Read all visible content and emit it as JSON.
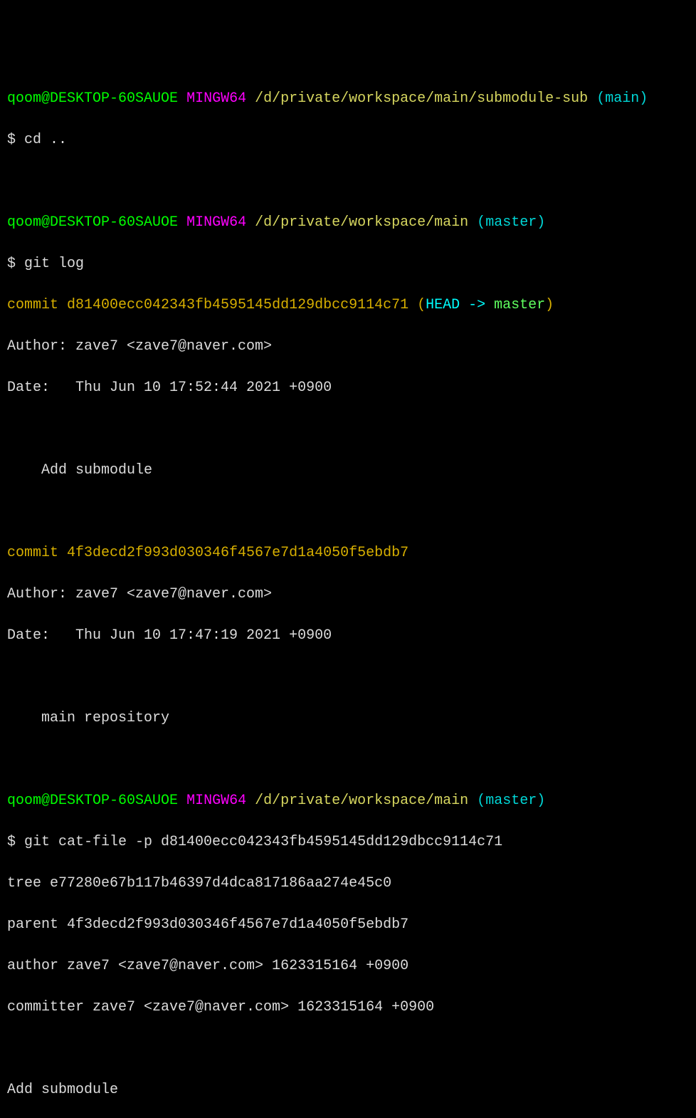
{
  "prompt1": {
    "user": "qoom@DESKTOP-60SAUOE",
    "shell": "MINGW64",
    "path": "/d/private/workspace/main/submodule-sub",
    "branch_open": "(",
    "branch": "main",
    "branch_close": ")"
  },
  "cmd1": "$ cd ..",
  "prompt2": {
    "user": "qoom@DESKTOP-60SAUOE",
    "shell": "MINGW64",
    "path": "/d/private/workspace/main",
    "branch_open": "(",
    "branch": "master",
    "branch_close": ")"
  },
  "cmd2": "$ git log",
  "log1": {
    "commit_label": "commit ",
    "hash": "d81400ecc042343fb4595145dd129dbcc9114c71",
    "ref_open": " (",
    "ref_head": "HEAD -> ",
    "ref_branch": "master",
    "ref_close": ")",
    "author": "Author: zave7 <zave7@naver.com>",
    "date": "Date:   Thu Jun 10 17:52:44 2021 +0900",
    "message": "    Add submodule"
  },
  "log2": {
    "commit_label": "commit ",
    "hash": "4f3decd2f993d030346f4567e7d1a4050f5ebdb7",
    "author": "Author: zave7 <zave7@naver.com>",
    "date": "Date:   Thu Jun 10 17:47:19 2021 +0900",
    "message": "    main repository"
  },
  "prompt3": {
    "user": "qoom@DESKTOP-60SAUOE",
    "shell": "MINGW64",
    "path": "/d/private/workspace/main",
    "branch_open": "(",
    "branch": "master",
    "branch_close": ")"
  },
  "cmd3": "$ git cat-file -p d81400ecc042343fb4595145dd129dbcc9114c71",
  "catfile": {
    "tree": "tree e77280e67b117b46397d4dca817186aa274e45c0",
    "parent": "parent 4f3decd2f993d030346f4567e7d1a4050f5ebdb7",
    "author": "author zave7 <zave7@naver.com> 1623315164 +0900",
    "committer": "committer zave7 <zave7@naver.com> 1623315164 +0900",
    "message": "Add submodule"
  }
}
